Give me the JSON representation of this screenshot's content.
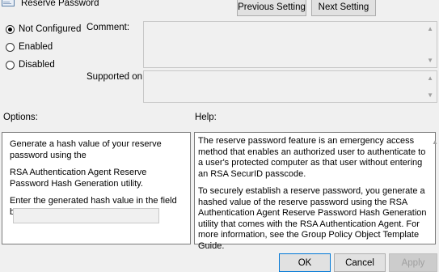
{
  "header": {
    "title": "Reserve Password",
    "previous_label": "Previous Setting",
    "next_label": "Next Setting"
  },
  "state": {
    "options": [
      {
        "label": "Not Configured",
        "checked": true
      },
      {
        "label": "Enabled",
        "checked": false
      },
      {
        "label": "Disabled",
        "checked": false
      }
    ]
  },
  "fields": {
    "comment_label": "Comment:",
    "supported_label": "Supported on:"
  },
  "sections": {
    "options_label": "Options:",
    "help_label": "Help:"
  },
  "options_panel": {
    "line1": "Generate a hash value of your reserve password using the",
    "line2": "RSA Authentication Agent Reserve Password Hash Generation utility.",
    "line3": "Enter the generated hash value in the field below.",
    "hash_value": ""
  },
  "help_panel": {
    "para1": "The reserve password feature is an emergency access method that enables an authorized user to authenticate to a user's protected computer as that user without entering an RSA SecurID passcode.",
    "para2": "To securely establish a reserve password, you generate a hashed value of the reserve password using the RSA Authentication Agent Reserve Password Hash Generation utility that comes with the RSA Authentication Agent. For more information, see the Group Policy Object Template Guide."
  },
  "footer": {
    "ok_label": "OK",
    "cancel_label": "Cancel",
    "apply_label": "Apply"
  },
  "icons": {
    "window": "policy-setting-icon",
    "scroll_up": "chevron-up-icon",
    "scroll_down": "chevron-down-icon"
  }
}
